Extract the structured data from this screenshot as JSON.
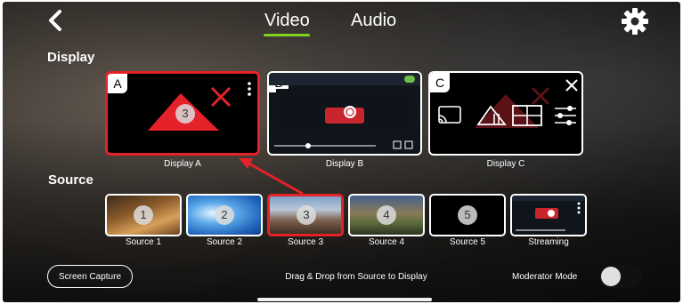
{
  "header": {
    "tabs": [
      {
        "label": "Video",
        "selected": true
      },
      {
        "label": "Audio",
        "selected": false
      }
    ],
    "icons": {
      "back": "chevron-left-icon",
      "settings": "gear-icon"
    }
  },
  "display_section": {
    "title": "Display",
    "cards": [
      {
        "id": "A",
        "caption": "Display A",
        "state": "no-signal",
        "assigned_source_number": "3",
        "active": true
      },
      {
        "id": "B",
        "caption": "Display B",
        "state": "streaming"
      },
      {
        "id": "C",
        "caption": "Display C",
        "state": "no-signal",
        "menu_open": true
      }
    ]
  },
  "source_section": {
    "title": "Source",
    "items": [
      {
        "number": "1",
        "label": "Source 1",
        "thumb": "desert"
      },
      {
        "number": "2",
        "label": "Source 2",
        "thumb": "sky"
      },
      {
        "number": "3",
        "label": "Source 3",
        "thumb": "mountains",
        "active": true
      },
      {
        "number": "4",
        "label": "Source 4",
        "thumb": "canyon"
      },
      {
        "number": "5",
        "label": "Source 5",
        "thumb": "black"
      },
      {
        "label": "Streaming",
        "thumb": "streaming"
      }
    ]
  },
  "footer": {
    "screen_capture_label": "Screen Capture",
    "instructions": "Drag & Drop from Source to Display",
    "moderator_label": "Moderator Mode",
    "moderator_on": false
  },
  "colors": {
    "accent": "#7ed321",
    "active": "#e5212a",
    "text": "#ffffff"
  }
}
